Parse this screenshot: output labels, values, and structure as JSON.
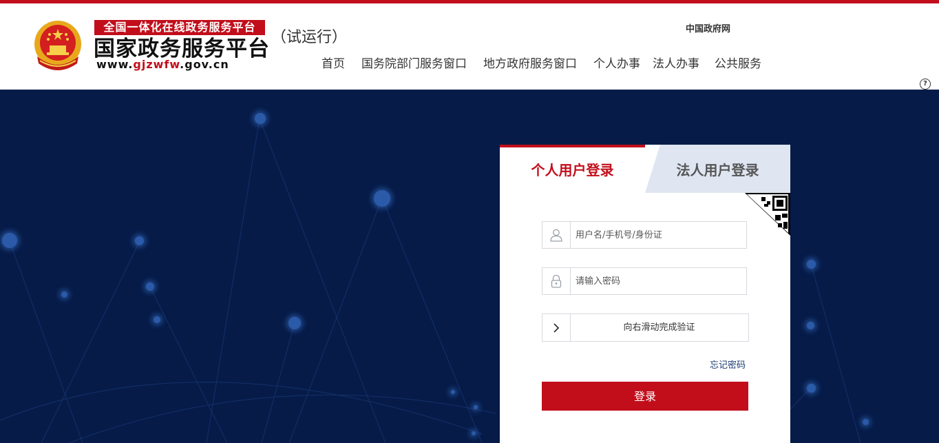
{
  "header": {
    "logo_tag": "全国一体化在线政务服务平台",
    "logo_title": "国家政务服务平台",
    "logo_url_prefix": "www.",
    "logo_url_highlight": "gjzwfw",
    "logo_url_suffix": ".gov.cn",
    "trial_label": "（试运行）",
    "gov_link": "中国政府网",
    "help_icon": "question-circle-icon"
  },
  "nav": {
    "items": [
      "首页",
      "国务院部门服务窗口",
      "地方政府服务窗口",
      "个人办事",
      "法人办事",
      "公共服务"
    ]
  },
  "login": {
    "tab_personal": "个人用户登录",
    "tab_corporate": "法人用户登录",
    "username_placeholder": "用户名/手机号/身份证",
    "password_placeholder": "请输入密码",
    "slider_text": "向右滑动完成验证",
    "forgot_password": "忘记密码",
    "login_button": "登录",
    "icons": [
      "user-icon",
      "lock-icon",
      "chevron-right-icon",
      "qr-code-icon"
    ]
  },
  "colors": {
    "brand_red": "#c20e1b",
    "hero_bg": "#061b48",
    "tab_inactive_bg": "#dfe6f2"
  }
}
